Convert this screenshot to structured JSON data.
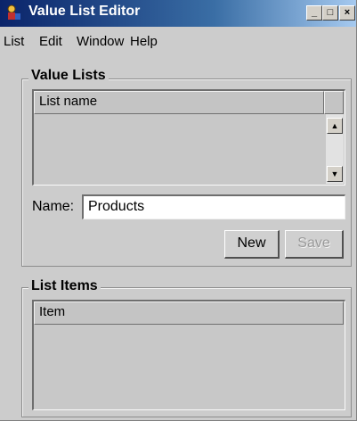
{
  "window": {
    "title": "Value List Editor",
    "controls": {
      "minimize": "_",
      "maximize": "□",
      "close": "×"
    }
  },
  "menu": [
    "List",
    "Edit",
    "Window",
    "Help"
  ],
  "value_lists": {
    "title": "Value Lists",
    "column_header": "List name",
    "name_label": "Name:",
    "name_value": "Products",
    "new_button": "New",
    "save_button": "Save",
    "scroll_up_icon": "▲",
    "scroll_down_icon": "▼"
  },
  "list_items": {
    "title": "List Items",
    "column_header": "Item"
  },
  "colors": {
    "titlebar_start": "#0a246a",
    "titlebar_end": "#a6caf0",
    "window_bg": "#cccccc"
  }
}
